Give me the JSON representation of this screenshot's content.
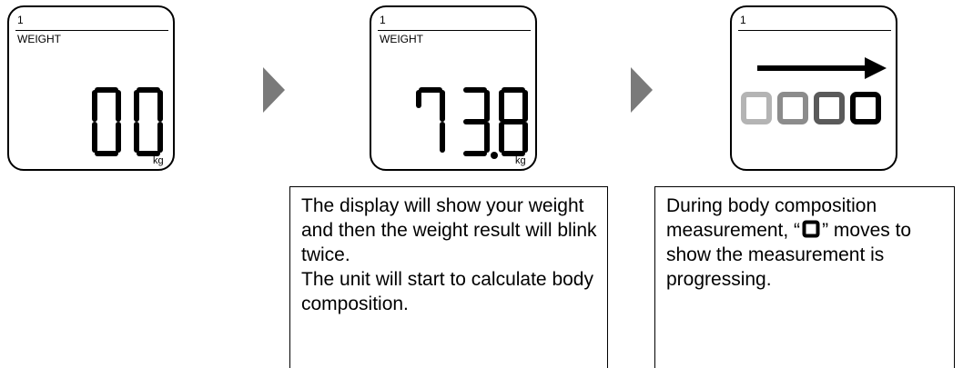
{
  "panels": [
    {
      "user_number": "1",
      "label": "WEIGHT",
      "reading": "00",
      "unit": "kg"
    },
    {
      "user_number": "1",
      "label": "WEIGHT",
      "reading": "73.8",
      "unit": "kg"
    },
    {
      "user_number": "1",
      "progress_icon": "progress-segment-icon"
    }
  ],
  "arrows": [
    "triangle-right-icon",
    "triangle-right-icon"
  ],
  "notes": {
    "weight": {
      "line1": "The display will show your weight and then the weight result will blink twice.",
      "line2": "The unit will start to calculate body composition."
    },
    "progress": {
      "before": "During body composition measurement, “",
      "after": "” moves to show the measurement is progressing."
    }
  },
  "colors": {
    "segment_active": "#000000",
    "segment_faded_1": "#b4b4b4",
    "segment_faded_2": "#8c8c8c",
    "segment_faded_3": "#5a5a5a",
    "arrow": "#7a7a7a"
  }
}
